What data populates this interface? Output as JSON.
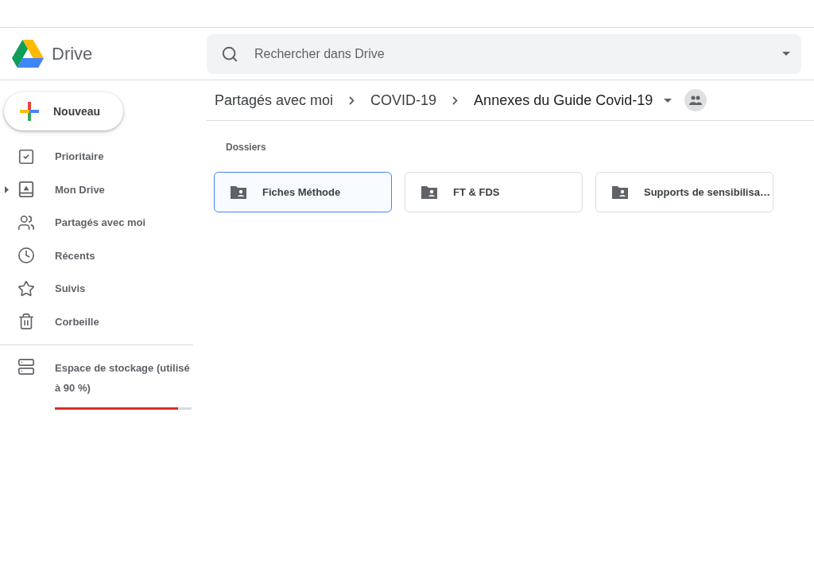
{
  "app": {
    "name": "Drive"
  },
  "search": {
    "placeholder": "Rechercher dans Drive"
  },
  "new_button": {
    "label": "Nouveau"
  },
  "nav": [
    {
      "kind": "priority",
      "label": "Prioritaire",
      "expandable": false
    },
    {
      "kind": "my-drive",
      "label": "Mon Drive",
      "expandable": true
    },
    {
      "kind": "shared",
      "label": "Partagés avec moi",
      "expandable": false
    },
    {
      "kind": "recent",
      "label": "Récents",
      "expandable": false
    },
    {
      "kind": "starred",
      "label": "Suivis",
      "expandable": false
    },
    {
      "kind": "trash",
      "label": "Corbeille",
      "expandable": false
    }
  ],
  "storage": {
    "label": "Espace de stockage (utilisé à 90 %)",
    "level": 0.9
  },
  "breadcrumb": [
    {
      "label": "Partagés avec moi",
      "current": false
    },
    {
      "label": "COVID-19",
      "current": false
    },
    {
      "label": "Annexes du Guide Covid-19",
      "current": true
    }
  ],
  "section_title": "Dossiers",
  "folders": [
    {
      "name": "Fiches Méthode",
      "selected": true
    },
    {
      "name": "FT & FDS",
      "selected": false
    },
    {
      "name": "Supports de sensibilisa…",
      "selected": false
    }
  ]
}
